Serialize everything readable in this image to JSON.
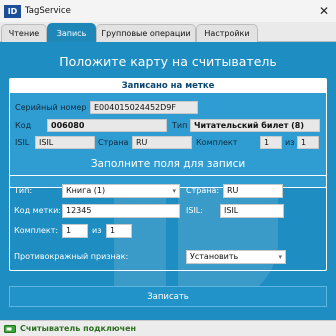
{
  "app": {
    "logo": "ID",
    "title": "TagService"
  },
  "tabs": [
    "Чтение",
    "Запись",
    "Групповые операции",
    "Настройки"
  ],
  "main": {
    "headline": "Положите карту на считыватель",
    "recorded": {
      "header": "Записано на метке",
      "serial_label": "Серийный номер",
      "serial_value": "E004015024452D9F",
      "code_label": "Код",
      "code_value": "006080",
      "type_label": "Тип",
      "type_value": "Читательский билет (8)",
      "isil_label": "ISIL",
      "isil_value": "ISIL",
      "country_label": "Страна",
      "country_value": "RU",
      "set_label": "Комплект",
      "set_value": "1",
      "of_label": "из",
      "of_value": "1"
    },
    "form_title": "Заполните поля для записи",
    "form": {
      "type_label": "Тип:",
      "type_value": "Книга (1)",
      "country_label": "Страна:",
      "country_value": "RU",
      "code_label": "Код метки:",
      "code_value": "12345",
      "isil_label": "ISIL:",
      "isil_value": "ISIL",
      "set_label": "Комплект:",
      "set_value": "1",
      "of_label": "из",
      "of_value": "1",
      "antitheft_label": "Противокражный признак:",
      "antitheft_value": "Установить"
    },
    "write_button": "Записать"
  },
  "status": {
    "text": "Считыватель подключен"
  },
  "colors": {
    "accent": "#1e8dc1",
    "active_tab": "#1f86b8",
    "status_ok": "#2b6f1f"
  }
}
